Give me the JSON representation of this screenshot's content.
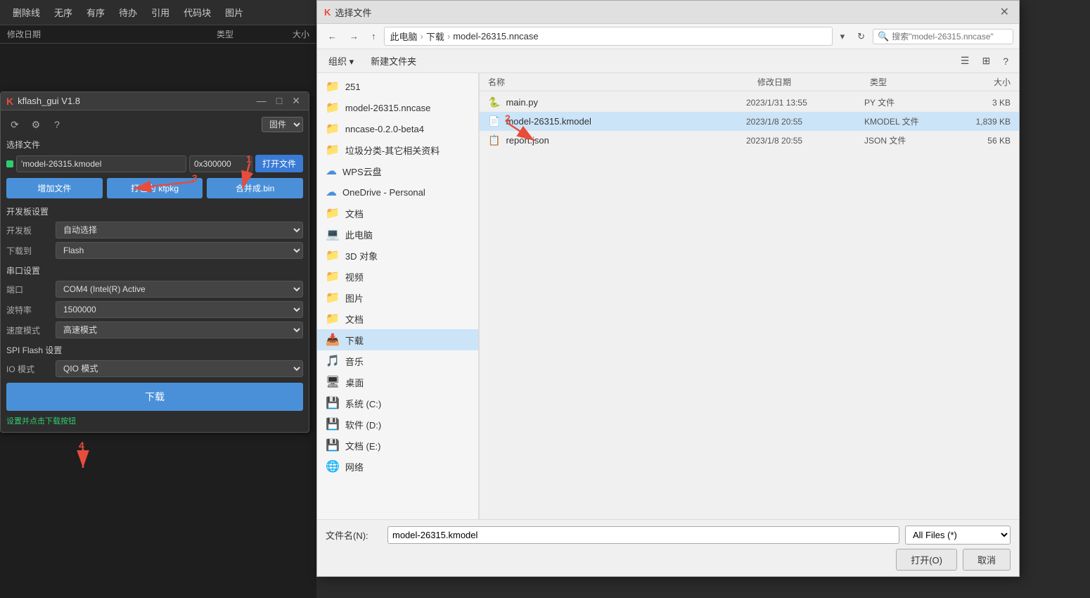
{
  "editor": {
    "toolbar_items": [
      "删除线",
      "无序",
      "有序",
      "待办",
      "引用",
      "代码块",
      "图片"
    ],
    "col_headers": [
      "修改日期",
      "类型",
      "大小"
    ]
  },
  "kflash": {
    "title": "kflash_gui V1.8",
    "logo": "K",
    "firmware_label": "固件",
    "file_path": "'model-26315.kmodel",
    "addr": "0x300000",
    "open_btn": "打开文件",
    "add_btn": "增加文件",
    "pack_btn": "打包为 kfpkg",
    "merge_btn": "合并成.bin",
    "board_section": "开发板设置",
    "board_label": "开发板",
    "board_value": "自动选择",
    "download_to_label": "下载到",
    "download_to_value": "Flash",
    "serial_section": "串口设置",
    "port_label": "端口",
    "port_value": "COM4 (Intel(R) Active",
    "baud_label": "波特率",
    "baud_value": "1500000",
    "speed_label": "速度模式",
    "speed_value": "高速模式",
    "spi_section": "SPI Flash 设置",
    "io_label": "IO 模式",
    "io_value": "QIO 模式",
    "download_btn": "下载",
    "status_text": "设置并点击下载按钮",
    "num1": "1",
    "num2": "2",
    "num3": "3",
    "num4": "4"
  },
  "file_dialog": {
    "title": "选择文件",
    "logo": "K",
    "breadcrumb": [
      "此电脑",
      "下载",
      "model-26315.nncase"
    ],
    "search_placeholder": "搜索\"model-26315.nncase\"",
    "organize_btn": "组织 ▾",
    "new_folder_btn": "新建文件夹",
    "left_panel": [
      {
        "icon": "📁",
        "label": "251",
        "type": "folder"
      },
      {
        "icon": "📁",
        "label": "model-26315.nncase",
        "type": "folder"
      },
      {
        "icon": "📁",
        "label": "nncase-0.2.0-beta4",
        "type": "folder"
      },
      {
        "icon": "📁",
        "label": "垃圾分类-其它相关资料",
        "type": "folder"
      },
      {
        "icon": "☁",
        "label": "WPS云盘",
        "type": "cloud"
      },
      {
        "icon": "☁",
        "label": "OneDrive - Personal",
        "type": "cloud"
      },
      {
        "icon": "📁",
        "label": "文档",
        "type": "folder"
      },
      {
        "icon": "💻",
        "label": "此电脑",
        "type": "pc"
      },
      {
        "icon": "📁",
        "label": "3D 对象",
        "type": "folder"
      },
      {
        "icon": "📁",
        "label": "视频",
        "type": "folder"
      },
      {
        "icon": "📁",
        "label": "图片",
        "type": "folder"
      },
      {
        "icon": "📁",
        "label": "文档",
        "type": "folder"
      },
      {
        "icon": "📥",
        "label": "下载",
        "type": "folder-selected"
      },
      {
        "icon": "🎵",
        "label": "音乐",
        "type": "folder"
      },
      {
        "icon": "🖥",
        "label": "桌面",
        "type": "folder"
      },
      {
        "icon": "💾",
        "label": "系统 (C:)",
        "type": "drive"
      },
      {
        "icon": "💾",
        "label": "软件 (D:)",
        "type": "drive"
      },
      {
        "icon": "💾",
        "label": "文档 (E:)",
        "type": "drive"
      },
      {
        "icon": "🌐",
        "label": "网络",
        "type": "network"
      }
    ],
    "col_headers": [
      "名称",
      "修改日期",
      "类型",
      "大小"
    ],
    "files": [
      {
        "icon": "🐍",
        "name": "main.py",
        "date": "2023/1/31 13:55",
        "type": "PY 文件",
        "size": "3 KB",
        "selected": false
      },
      {
        "icon": "📄",
        "name": "model-26315.kmodel",
        "date": "2023/1/8 20:55",
        "type": "KMODEL 文件",
        "size": "1,839 KB",
        "selected": true
      },
      {
        "icon": "📋",
        "name": "report.json",
        "date": "2023/1/8 20:55",
        "type": "JSON 文件",
        "size": "56 KB",
        "selected": false
      }
    ],
    "filename_label": "文件名(N):",
    "filename_value": "model-26315.kmodel",
    "filetype_value": "All Files (*)",
    "ok_btn": "打开(O)",
    "cancel_btn": "取消"
  }
}
